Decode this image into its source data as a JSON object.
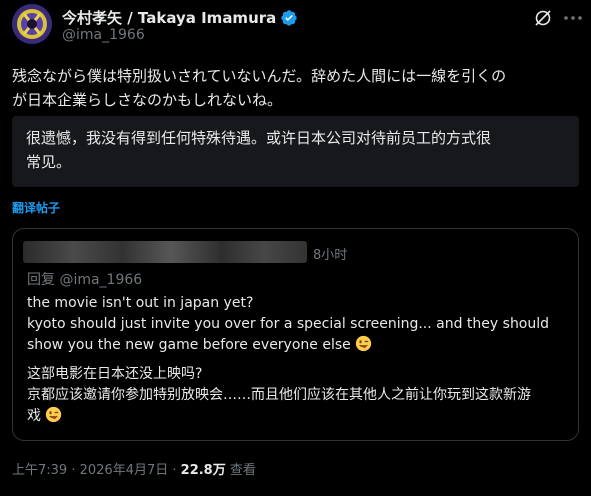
{
  "author": {
    "display_name": "今村孝矢 / Takaya Imamura",
    "handle": "@ima_1966",
    "verified": true
  },
  "tweet": {
    "text_line1": "残念ながら僕は特別扱いされていないんだ。辞めた人間には一線を引くの",
    "text_line2": "が日本企業らしさなのかもしれないね。",
    "translation_line1": "很遗憾，我没有得到任何特殊待遇。或许日本公司对待前员工的方式很",
    "translation_line2": "常见。",
    "translate_label": "翻译帖子"
  },
  "quote": {
    "time_ago": "8小时",
    "reply_to": "回复 @ima_1966",
    "line1": "the movie isn't out in japan yet?",
    "line2": "kyoto should just invite you over for a special screening... and they should",
    "line3": "show you the new game before everyone else",
    "zh_line1": "这部电影在日本还没上映吗?",
    "zh_line2": "京都应该邀请你参加特别放映会……而且他们应该在其他人之前让你玩到这款新游",
    "zh_line3": "戏"
  },
  "footer": {
    "time": "上午7:39",
    "sep1": " · ",
    "date": "2026年4月7日",
    "sep2": " · ",
    "views": "22.8万",
    "views_label": " 查看"
  },
  "icons": {
    "verified": "verified-badge-icon",
    "grok": "grok-icon",
    "more": "more-options-icon",
    "emoji": "winking-tongue-face-emoji"
  },
  "colors": {
    "background": "#000000",
    "text": "#e7e9ea",
    "muted": "#71767b",
    "accent": "#1d9bf0",
    "translation_bg": "#16181c",
    "border": "#2f3336"
  }
}
